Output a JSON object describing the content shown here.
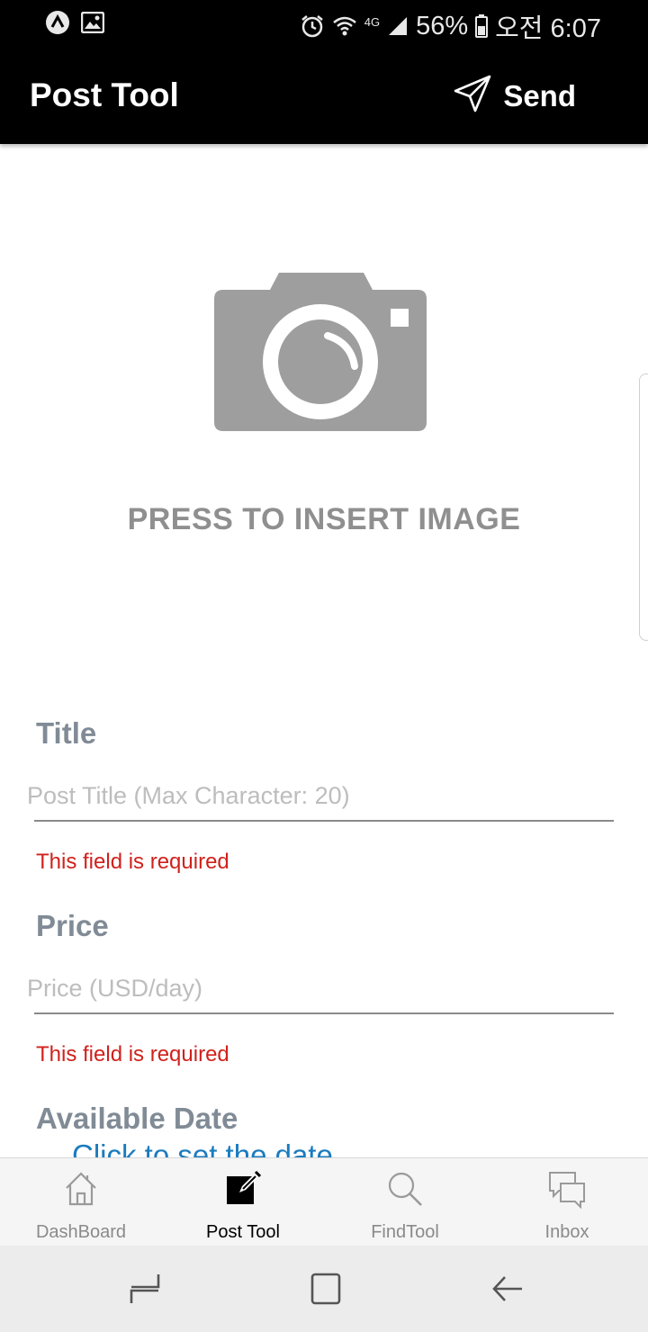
{
  "status_bar": {
    "battery": "56%",
    "time": "오전 6:07",
    "network": "4G",
    "left_icons": [
      "app-notification-icon",
      "image-notification-icon"
    ],
    "right_icons": [
      "alarm-icon",
      "wifi-icon",
      "signal-icon",
      "battery-icon"
    ]
  },
  "app_bar": {
    "title": "Post Tool",
    "send_label": "Send"
  },
  "image_picker": {
    "label": "PRESS TO INSERT IMAGE",
    "icon": "camera-icon"
  },
  "form": {
    "title": {
      "label": "Title",
      "placeholder": "Post Title (Max Character: 20)",
      "value": "",
      "error": "This field is required"
    },
    "price": {
      "label": "Price",
      "placeholder": "Price (USD/day)",
      "value": "",
      "error": "This field is required"
    },
    "date": {
      "label": "Available Date",
      "link": "Click to set the date"
    }
  },
  "bottom_nav": {
    "items": [
      {
        "label": "DashBoard",
        "icon": "home-icon"
      },
      {
        "label": "Post Tool",
        "icon": "edit-icon"
      },
      {
        "label": "FindTool",
        "icon": "search-icon"
      },
      {
        "label": "Inbox",
        "icon": "chat-icon"
      }
    ],
    "active": "Post Tool"
  },
  "colors": {
    "app_bar": "#000000",
    "label": "#808b96",
    "error": "#d0211c",
    "link": "#1a7bbf",
    "camera": "#9e9e9e"
  }
}
